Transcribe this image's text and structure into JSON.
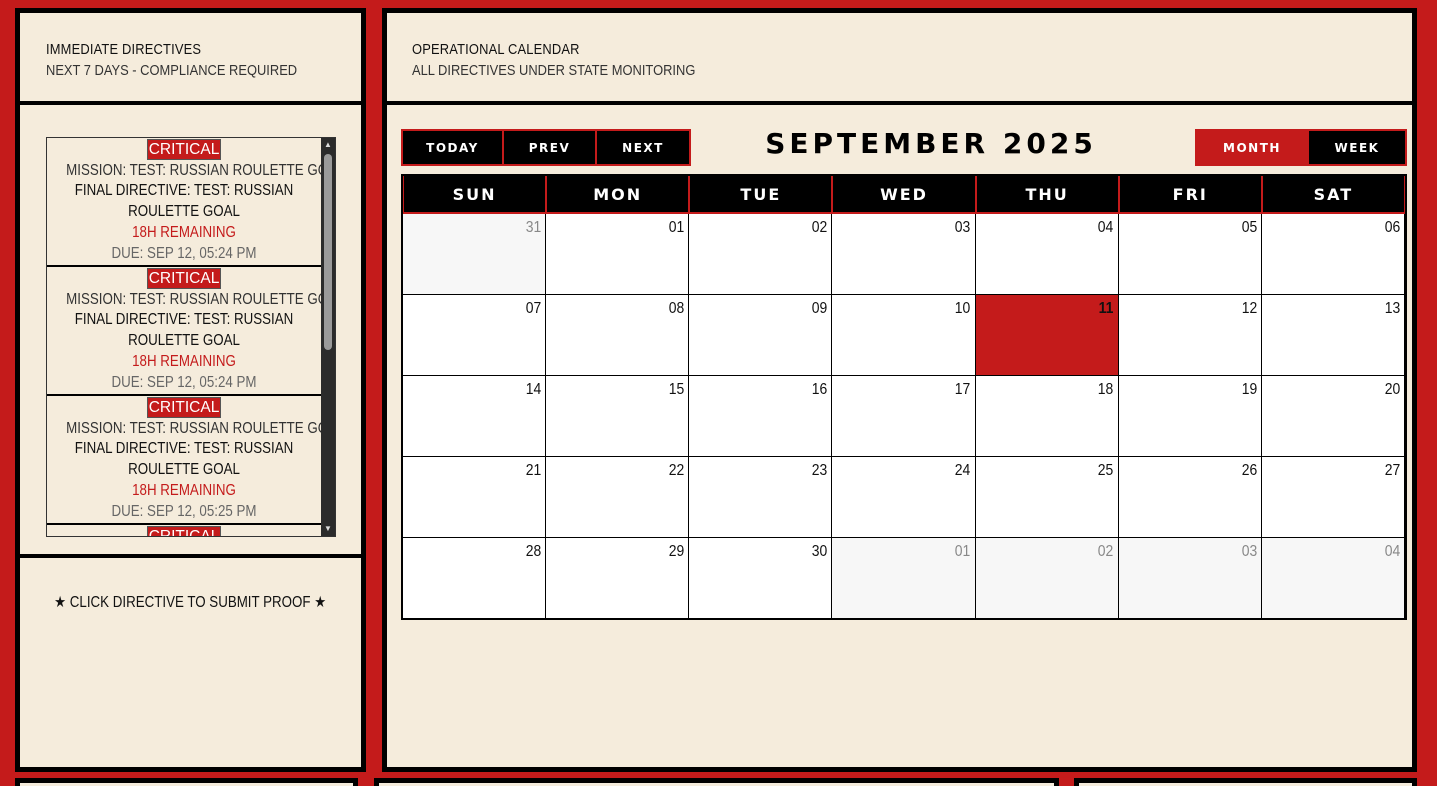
{
  "directives_panel": {
    "title": "IMMEDIATE DIRECTIVES",
    "subtitle": "NEXT 7 DAYS - COMPLIANCE REQUIRED",
    "items": [
      {
        "badge": "CRITICAL",
        "mission": "MISSION: TEST: RUSSIAN ROULETTE GOAL",
        "final_line1": "FINAL DIRECTIVE: TEST: RUSSIAN",
        "final_line2": "ROULETTE GOAL",
        "remaining": "18H REMAINING",
        "due": "DUE: SEP 12, 05:24 PM"
      },
      {
        "badge": "CRITICAL",
        "mission": "MISSION: TEST: RUSSIAN ROULETTE GOAL",
        "final_line1": "FINAL DIRECTIVE: TEST: RUSSIAN",
        "final_line2": "ROULETTE GOAL",
        "remaining": "18H REMAINING",
        "due": "DUE: SEP 12, 05:24 PM"
      },
      {
        "badge": "CRITICAL",
        "mission": "MISSION: TEST: RUSSIAN ROULETTE GOAL",
        "final_line1": "FINAL DIRECTIVE: TEST: RUSSIAN",
        "final_line2": "ROULETTE GOAL",
        "remaining": "18H REMAINING",
        "due": "DUE: SEP 12, 05:25 PM"
      },
      {
        "badge": "CRITICAL"
      }
    ],
    "proof_hint": "★ CLICK DIRECTIVE TO SUBMIT PROOF ★"
  },
  "calendar_panel": {
    "title": "OPERATIONAL CALENDAR",
    "subtitle": "ALL DIRECTIVES UNDER STATE MONITORING",
    "toolbar": {
      "today": "TODAY",
      "prev": "PREV",
      "next": "NEXT",
      "month_title": "SEPTEMBER 2025",
      "month": "MONTH",
      "week": "WEEK",
      "active_view": "month"
    },
    "weekdays": [
      "SUN",
      "MON",
      "TUE",
      "WED",
      "THU",
      "FRI",
      "SAT"
    ],
    "weeks": [
      [
        {
          "d": "31",
          "other": true
        },
        {
          "d": "01"
        },
        {
          "d": "02"
        },
        {
          "d": "03"
        },
        {
          "d": "04"
        },
        {
          "d": "05"
        },
        {
          "d": "06"
        }
      ],
      [
        {
          "d": "07"
        },
        {
          "d": "08"
        },
        {
          "d": "09"
        },
        {
          "d": "10"
        },
        {
          "d": "11",
          "today": true
        },
        {
          "d": "12"
        },
        {
          "d": "13"
        }
      ],
      [
        {
          "d": "14"
        },
        {
          "d": "15"
        },
        {
          "d": "16"
        },
        {
          "d": "17"
        },
        {
          "d": "18"
        },
        {
          "d": "19"
        },
        {
          "d": "20"
        }
      ],
      [
        {
          "d": "21"
        },
        {
          "d": "22"
        },
        {
          "d": "23"
        },
        {
          "d": "24"
        },
        {
          "d": "25"
        },
        {
          "d": "26"
        },
        {
          "d": "27"
        }
      ],
      [
        {
          "d": "28"
        },
        {
          "d": "29"
        },
        {
          "d": "30"
        },
        {
          "d": "01",
          "other": true
        },
        {
          "d": "02",
          "other": true
        },
        {
          "d": "03",
          "other": true
        },
        {
          "d": "04",
          "other": true
        }
      ]
    ]
  },
  "colors": {
    "accent_red": "#c41b1b",
    "panel_bg": "#f5ecdc",
    "border": "#000000"
  },
  "icons": {
    "scroll_up": "triangle-up",
    "scroll_down": "triangle-down"
  }
}
